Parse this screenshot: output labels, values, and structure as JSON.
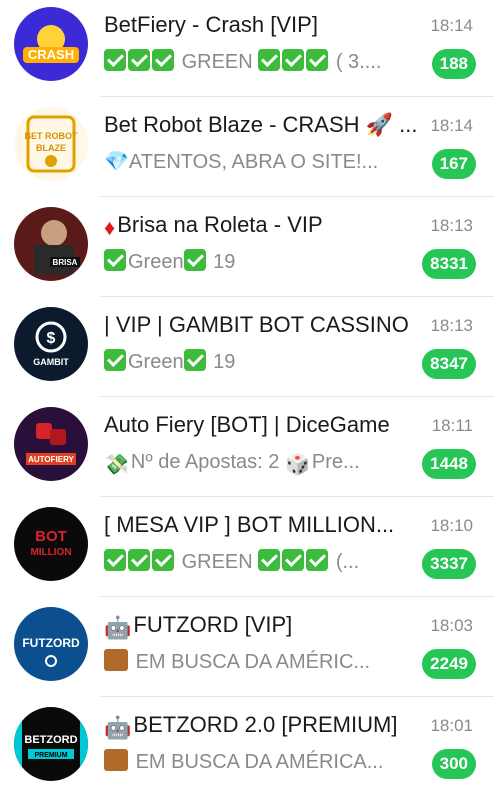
{
  "chats": [
    {
      "title": "BetFiery - Crash [VIP]",
      "time": "18:14",
      "preview_prefix_checks": 3,
      "preview_text": "GREEN",
      "preview_suffix_checks": 3,
      "preview_tail": "( 3....",
      "unread": "188",
      "avatar_text": "CRASH"
    },
    {
      "title": "Bet Robot Blaze - CRASH 🚀 ...",
      "time": "18:14",
      "preview_text": "💎ATENTOS, ABRA O SITE!...",
      "unread": "167",
      "avatar_text": "BET ROBOT BLAZE"
    },
    {
      "title_icon": "red-diamond-icon",
      "title": "Brisa na Roleta - VIP",
      "time": "18:13",
      "preview_text": "Green",
      "preview_tail": "19",
      "unread": "8331",
      "avatar_text": "BRISA"
    },
    {
      "title": "| VIP | GAMBIT BOT CASSINO",
      "time": "18:13",
      "preview_text": "Green",
      "preview_tail": "19",
      "unread": "8347",
      "avatar_text": "GAMBIT"
    },
    {
      "title": "Auto Fiery [BOT] | DiceGame",
      "time": "18:11",
      "preview_text": "Nº de Apostas: 2",
      "preview_tail": "Pre...",
      "unread": "1448",
      "avatar_text": "AUTOFIERY"
    },
    {
      "title": "[ MESA VIP ] BOT MILLION...",
      "time": "18:10",
      "preview_text": "GREEN",
      "preview_tail": "(...",
      "unread": "3337",
      "avatar_text": "BOT MILLION"
    },
    {
      "title_icon": "robot-icon",
      "title": "FUTZORD [VIP]",
      "time": "18:03",
      "preview_text": "EM BUSCA DA AMÉRIC...",
      "unread": "2249",
      "avatar_text": "FUTZORD"
    },
    {
      "title_icon": "robot-icon",
      "title": "BETZORD 2.0 [PREMIUM]",
      "time": "18:01",
      "preview_text": "EM BUSCA DA AMÉRICA...",
      "unread": "300",
      "avatar_text": "BETZORD PREMIUM"
    }
  ],
  "colors": {
    "badge": "#25c655",
    "time": "#8a8a8a",
    "title": "#1a1a1a"
  }
}
